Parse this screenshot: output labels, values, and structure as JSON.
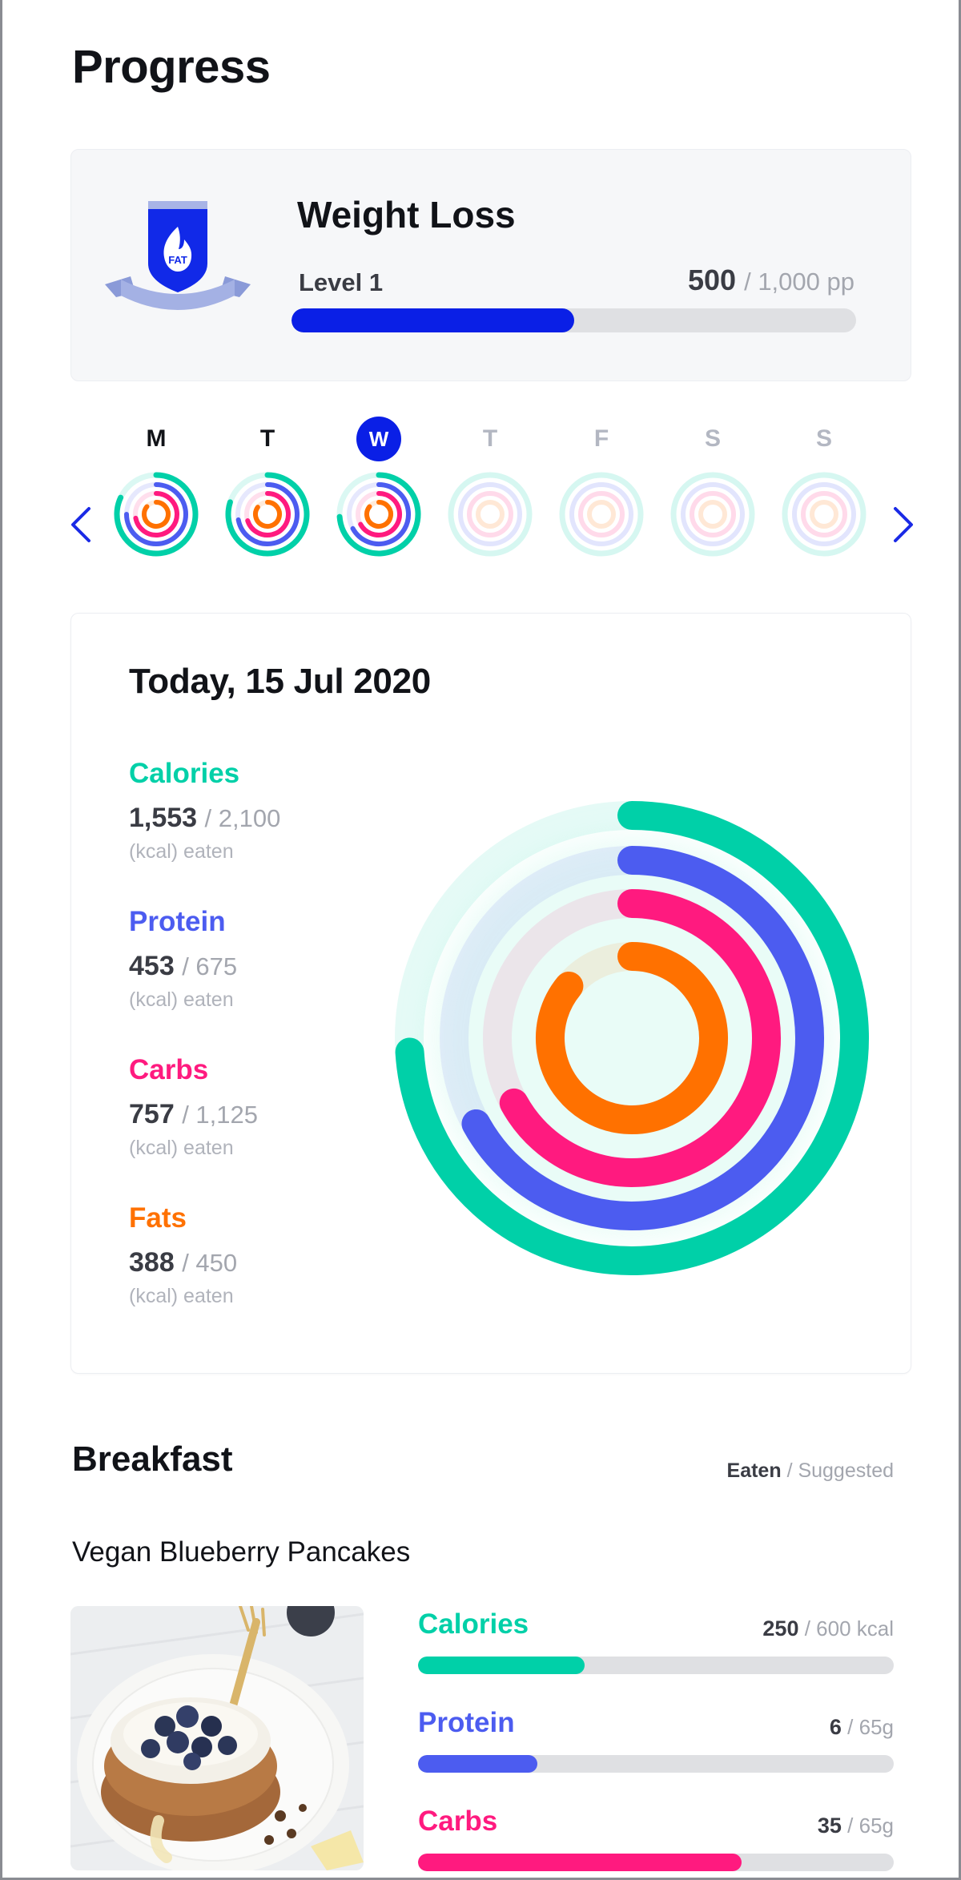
{
  "page": {
    "title": "Progress"
  },
  "goal": {
    "title": "Weight Loss",
    "badge_text": "FAT",
    "level": "Level 1",
    "points_current": "500",
    "points_rest": "/ 1,000 pp",
    "progress": 0.5
  },
  "week": {
    "days": [
      {
        "label": "M",
        "state": "past",
        "progress": [
          0.82,
          0.75,
          0.72,
          0.86
        ]
      },
      {
        "label": "T",
        "state": "past",
        "progress": [
          0.8,
          0.72,
          0.7,
          0.85
        ]
      },
      {
        "label": "W",
        "state": "active",
        "progress": [
          0.74,
          0.67,
          0.67,
          0.86
        ]
      },
      {
        "label": "T",
        "state": "future",
        "progress": [
          0,
          0,
          0,
          0
        ]
      },
      {
        "label": "F",
        "state": "future",
        "progress": [
          0,
          0,
          0,
          0
        ]
      },
      {
        "label": "S",
        "state": "future",
        "progress": [
          0,
          0,
          0,
          0
        ]
      },
      {
        "label": "S",
        "state": "future",
        "progress": [
          0,
          0,
          0,
          0
        ]
      }
    ]
  },
  "summary": {
    "date": "Today, 15 Jul 2020",
    "stats": [
      {
        "name": "Calories",
        "eaten": "1,553",
        "goal": "/ 2,100",
        "unit": "(kcal) eaten",
        "color": "#00d0a8",
        "fraction": 0.74
      },
      {
        "name": "Protein",
        "eaten": "453",
        "goal": "/ 675",
        "unit": "(kcal) eaten",
        "color": "#4c5cf0",
        "fraction": 0.67
      },
      {
        "name": "Carbs",
        "eaten": "757",
        "goal": "/ 1,125",
        "unit": "(kcal) eaten",
        "color": "#ff1a7f",
        "fraction": 0.67
      },
      {
        "name": "Fats",
        "eaten": "388",
        "goal": "/ 450",
        "unit": "(kcal) eaten",
        "color": "#ff7100",
        "fraction": 0.86
      }
    ]
  },
  "meal": {
    "title": "Breakfast",
    "legend_eaten": "Eaten",
    "legend_suggested": "/ Suggested",
    "name": "Vegan Blueberry Pancakes",
    "macros": [
      {
        "name": "Calories",
        "eaten": "250",
        "goal": "/ 600 kcal",
        "color": "#00d0a8",
        "fraction": 0.35
      },
      {
        "name": "Protein",
        "eaten": "6",
        "goal": "/ 65g",
        "color": "#4c5cf0",
        "fraction": 0.25
      },
      {
        "name": "Carbs",
        "eaten": "35",
        "goal": "/ 65g",
        "color": "#ff1a7f",
        "fraction": 0.68
      }
    ]
  }
}
